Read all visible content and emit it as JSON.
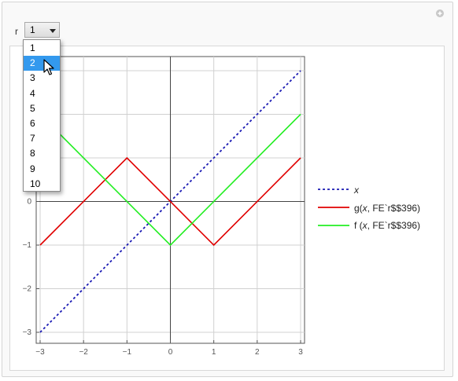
{
  "control": {
    "label": "r",
    "selected": "1",
    "options": [
      "1",
      "2",
      "3",
      "4",
      "5",
      "6",
      "7",
      "8",
      "9",
      "10"
    ],
    "highlighted": "2"
  },
  "chart_data": {
    "type": "line",
    "xlim": [
      -3,
      3
    ],
    "ylim": [
      -3,
      3
    ],
    "x_ticks": [
      "-3",
      "-2",
      "-1",
      "0",
      "1",
      "2",
      "3"
    ],
    "y_ticks": [
      "-3",
      "-2",
      "-1",
      "0"
    ],
    "grid": true,
    "legend_position": "right",
    "series": [
      {
        "name": "x",
        "style": "dashed",
        "color": "#1a1ab3",
        "x": [
          -3,
          3
        ],
        "y": [
          -3,
          3
        ]
      },
      {
        "name": "g(x, FE`r$$396)",
        "style": "solid",
        "color": "#e00000",
        "x": [
          -3,
          -1,
          1,
          3
        ],
        "y": [
          -1,
          1,
          -1,
          1
        ]
      },
      {
        "name": "f (x, FE`r$$396)",
        "style": "solid",
        "color": "#22ee22",
        "x": [
          -3,
          0,
          3
        ],
        "y": [
          2,
          -1,
          2
        ]
      }
    ]
  },
  "legend": [
    {
      "pre": "",
      "var": "x",
      "post": ""
    },
    {
      "pre": "g(",
      "var": "x",
      "post": ", FE`r$$396)"
    },
    {
      "pre": "f (",
      "var": "x",
      "post": ", FE`r$$396)"
    }
  ]
}
